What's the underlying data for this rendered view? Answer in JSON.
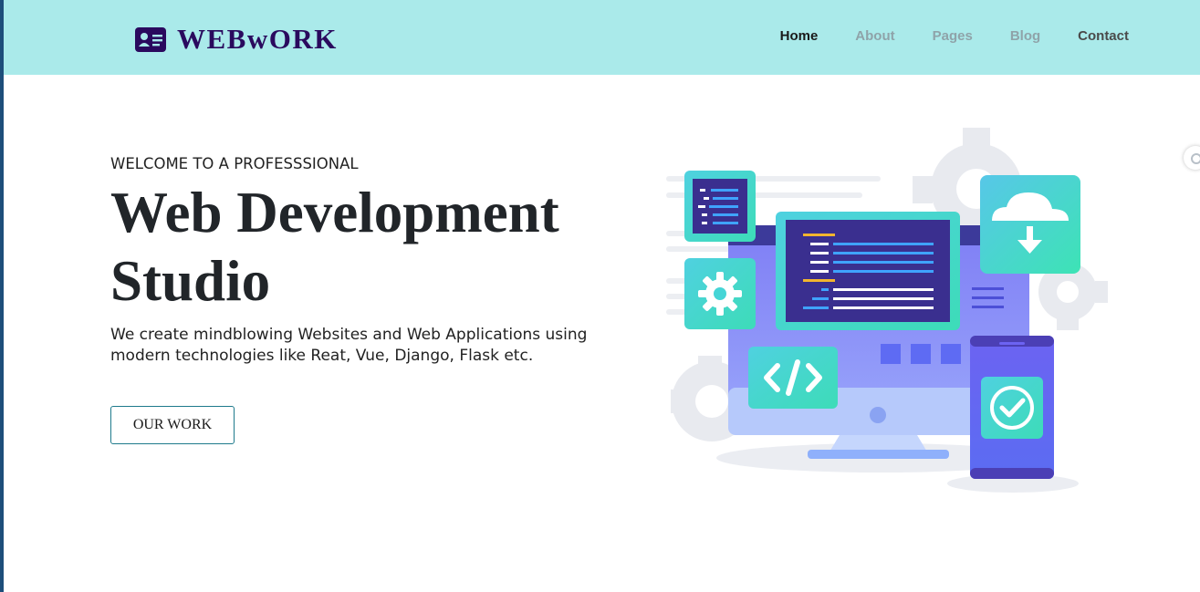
{
  "brand": {
    "name": "WEBwORK",
    "icon": "id-card-icon"
  },
  "nav": {
    "items": [
      {
        "label": "Home"
      },
      {
        "label": "About"
      },
      {
        "label": "Pages"
      },
      {
        "label": "Blog"
      },
      {
        "label": "Contact"
      }
    ]
  },
  "hero": {
    "eyebrow": "WELCOME TO A PROFESSSIONAL",
    "title_line1": "Web Development",
    "title_line2": "Studio",
    "description": "We create mindblowing Websites and Web Applications using modern technologies like Reat, Vue, Django, Flask etc.",
    "cta_label": "OUR WORK"
  },
  "colors": {
    "navbar_bg": "#aaeaea",
    "brand": "#2a0a5e",
    "nav_active": "#1a1a1a",
    "nav_muted": "#8fa3a9",
    "button_border": "#1e7a8c"
  }
}
